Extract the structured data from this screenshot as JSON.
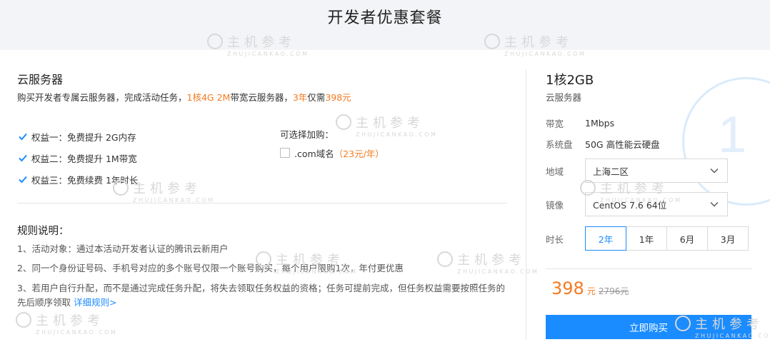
{
  "header": {
    "title": "开发者优惠套餐"
  },
  "left": {
    "title": "云服务器",
    "desc": {
      "prefix": "购买开发者专属云服务器，完成活动任务，",
      "highlight1": "1核4G 2M",
      "middle": "带宽云服务器，",
      "highlight2": "3年",
      "middle2": "仅需",
      "highlight3": "398元"
    },
    "benefits": [
      "权益一：免费提升 2G内存",
      "权益二：免费提升 1M带宽",
      "权益三：免费续费 1年时长"
    ],
    "addon": {
      "title": "可选择加购：",
      "item": ".com域名",
      "price": "（23元/年）"
    },
    "rules": {
      "title": "规则说明：",
      "items": [
        "1、活动对象：通过本活动开发者认证的腾讯云新用户",
        "2、同一个身份证号码、手机号对应的多个账号仅限一个账号购买，每个用户限购1次，年付更优惠",
        "3、若用户自行升配，而不是通过完成任务升配，将失去领取任务权益的资格；任务可提前完成，但任务权益需要按照任务的先后顺序领取"
      ],
      "link": "详细规则>"
    }
  },
  "right": {
    "title": "1核2GB",
    "subtitle": "云服务器",
    "bandwidth": {
      "label": "带宽",
      "value": "1Mbps"
    },
    "disk": {
      "label": "系统盘",
      "value": "50G 高性能云硬盘"
    },
    "region": {
      "label": "地域",
      "value": "上海二区"
    },
    "image": {
      "label": "镜像",
      "value": "CentOS 7.6 64位"
    },
    "duration": {
      "label": "时长",
      "options": [
        "2年",
        "1年",
        "6月",
        "3月"
      ],
      "selected": "2年"
    },
    "price": {
      "now": "398",
      "unit": "元",
      "old": "2796元"
    },
    "buy_label": "立即购买",
    "deco_number": "1"
  },
  "watermark": {
    "main": "主机参考",
    "sub": "ZHUJICANKAO.COM"
  },
  "colors": {
    "accent": "#1a8cff",
    "orange": "#f57a21"
  }
}
